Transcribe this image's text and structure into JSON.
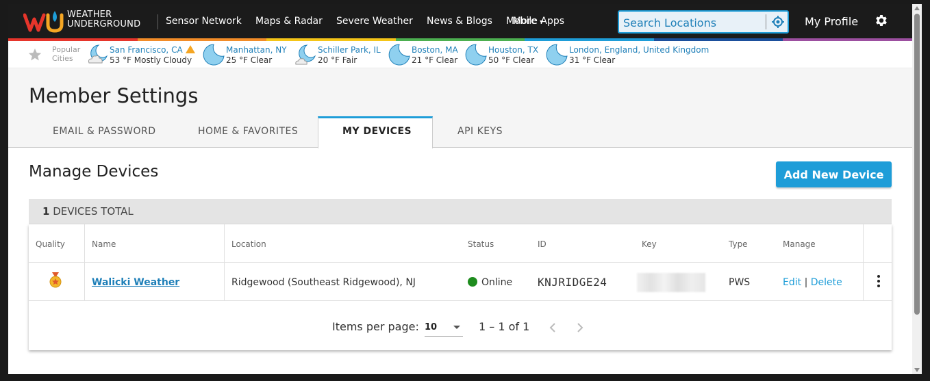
{
  "nav": {
    "logo_line1": "WEATHER",
    "logo_line2": "UNDERGROUND",
    "items": [
      "Sensor Network",
      "Maps & Radar",
      "Severe Weather",
      "News & Blogs",
      "Mobile Apps",
      "More"
    ],
    "search_placeholder": "Search Locations",
    "profile": "My Profile",
    "rainbow": [
      "#e6352b",
      "#f28c28",
      "#f5c518",
      "#4caf50",
      "#1e9dd8",
      "#1b4f9c",
      "#9c4fa0"
    ]
  },
  "cities": {
    "label_line1": "Popular",
    "label_line2": "Cities",
    "items": [
      {
        "name": "San Francisco, CA",
        "cond": "53 °F Mostly Cloudy",
        "icon": "moon-cloud-icon",
        "alert": true
      },
      {
        "name": "Manhattan, NY",
        "cond": "25 °F Clear",
        "icon": "moon-icon",
        "alert": false
      },
      {
        "name": "Schiller Park, IL",
        "cond": "20 °F Fair",
        "icon": "moon-cloud-icon",
        "alert": false
      },
      {
        "name": "Boston, MA",
        "cond": "21 °F Clear",
        "icon": "moon-icon",
        "alert": false
      },
      {
        "name": "Houston, TX",
        "cond": "50 °F Clear",
        "icon": "moon-icon",
        "alert": false
      },
      {
        "name": "London, England, United Kingdom",
        "cond": "31 °F Clear",
        "icon": "moon-icon",
        "alert": false
      }
    ]
  },
  "settings": {
    "title": "Member Settings",
    "tabs": [
      "EMAIL & PASSWORD",
      "HOME & FAVORITES",
      "MY DEVICES",
      "API KEYS"
    ],
    "active_tab": "MY DEVICES"
  },
  "devices": {
    "title": "Manage Devices",
    "add_button": "Add New Device",
    "total_count": "1",
    "total_label": "DEVICES TOTAL",
    "columns": [
      "Quality",
      "Name",
      "Location",
      "Status",
      "ID",
      "Key",
      "Type",
      "Manage"
    ],
    "rows": [
      {
        "name": "Walicki Weather",
        "location": "Ridgewood (Southeast Ridgewood), NJ",
        "status": "Online",
        "id": "KNJRIDGE24",
        "type": "PWS",
        "edit": "Edit",
        "sep": "|",
        "delete": "Delete"
      }
    ],
    "items_per_page_label": "Items per page:",
    "items_per_page": "10",
    "range": "1 – 1 of 1"
  }
}
